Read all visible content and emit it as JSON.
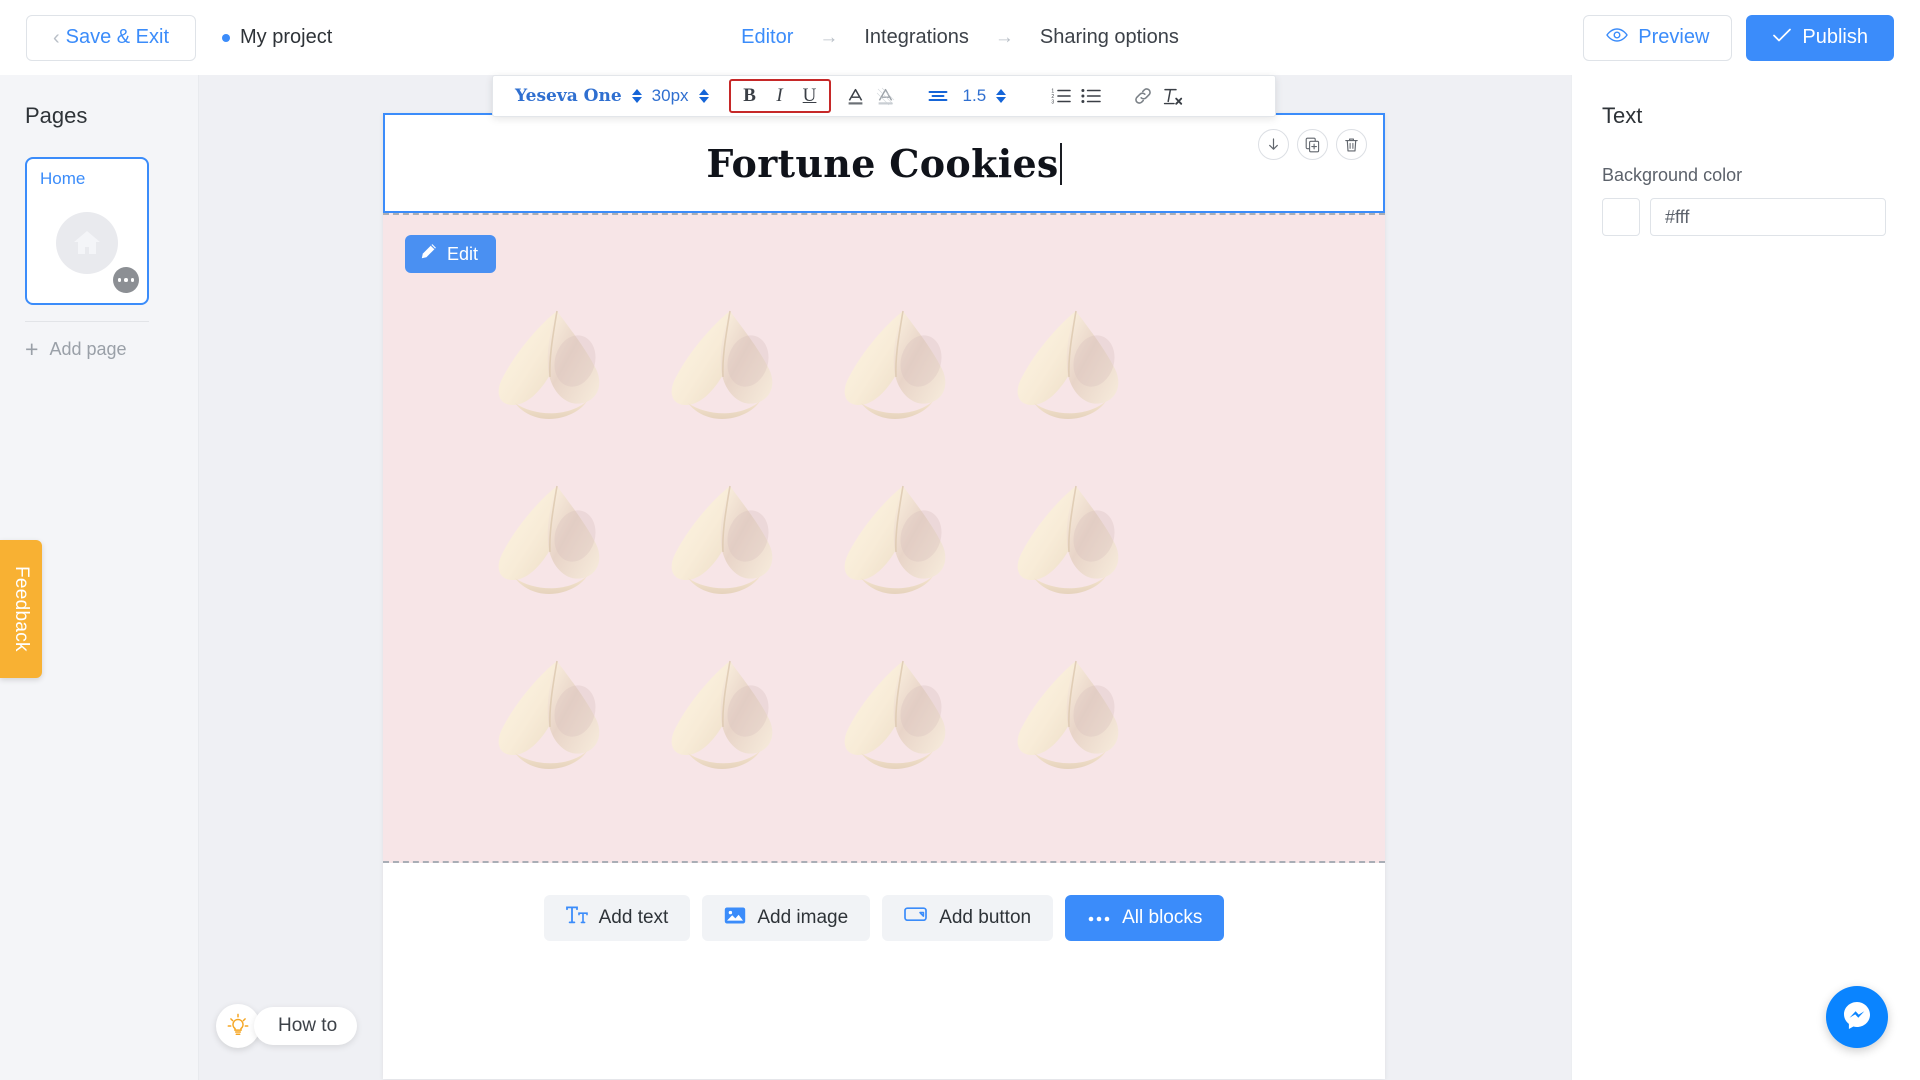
{
  "topbar": {
    "save_exit_label": "Save & Exit",
    "back_chevron_icon": "chevron-left-icon",
    "project_name": "My project",
    "breadcrumb": [
      {
        "label": "Editor",
        "active": true
      },
      {
        "label": "Integrations",
        "active": false
      },
      {
        "label": "Sharing options",
        "active": false
      }
    ],
    "arrow_glyph": "→",
    "preview_label": "Preview",
    "preview_icon": "eye-icon",
    "publish_label": "Publish",
    "publish_icon": "check-icon",
    "accent_color": "#3b8cfa"
  },
  "sidebar": {
    "title": "Pages",
    "page_card": {
      "label": "Home",
      "thumbnail_icon": "home-icon",
      "more_menu_icon": "more-dots-icon"
    },
    "add_page_label": "Add page",
    "add_page_icon": "plus-icon",
    "feedback_label": "Feedback",
    "feedback_color": "#f8b133"
  },
  "format_toolbar": {
    "font_family": "Yeseva One",
    "font_size": "30px",
    "line_height": "1.5",
    "bold_label": "B",
    "italic_label": "I",
    "underline_label": "U",
    "text_color_icon": "text-color-icon",
    "highlight_icon": "text-highlight-icon",
    "align_icon": "align-center-icon",
    "ordered_list_icon": "ordered-list-icon",
    "bullet_list_icon": "bullet-list-icon",
    "link_icon": "link-icon",
    "clear_format_icon": "clear-formatting-icon",
    "highlight_box_color": "#c62828",
    "toolbar_text_color": "#2f6fd0"
  },
  "canvas": {
    "text_block": {
      "heading": "Fortune Cookies",
      "selected": true,
      "actions": [
        {
          "name": "move-down-icon",
          "title": "Move down"
        },
        {
          "name": "duplicate-icon",
          "title": "Duplicate"
        },
        {
          "name": "delete-icon",
          "title": "Delete"
        }
      ]
    },
    "image_block": {
      "edit_label": "Edit",
      "edit_icon": "pencil-icon",
      "background_color": "#f7e5e7",
      "cookie_count": 12,
      "cookie_alt": "fortune-cookie"
    },
    "add_bar": [
      {
        "label": "Add text",
        "icon": "text-icon",
        "primary": false
      },
      {
        "label": "Add image",
        "icon": "image-icon",
        "primary": false
      },
      {
        "label": "Add button",
        "icon": "button-icon",
        "primary": false
      },
      {
        "label": "All blocks",
        "icon": "dots-icon",
        "primary": true
      }
    ]
  },
  "right_panel": {
    "title": "Text",
    "background_color_label": "Background color",
    "background_color_value": "#fff"
  },
  "helpers": {
    "how_to_label": "How to",
    "how_to_icon": "lightbulb-icon",
    "messenger_icon": "messenger-icon",
    "messenger_color": "#0a84ff"
  }
}
